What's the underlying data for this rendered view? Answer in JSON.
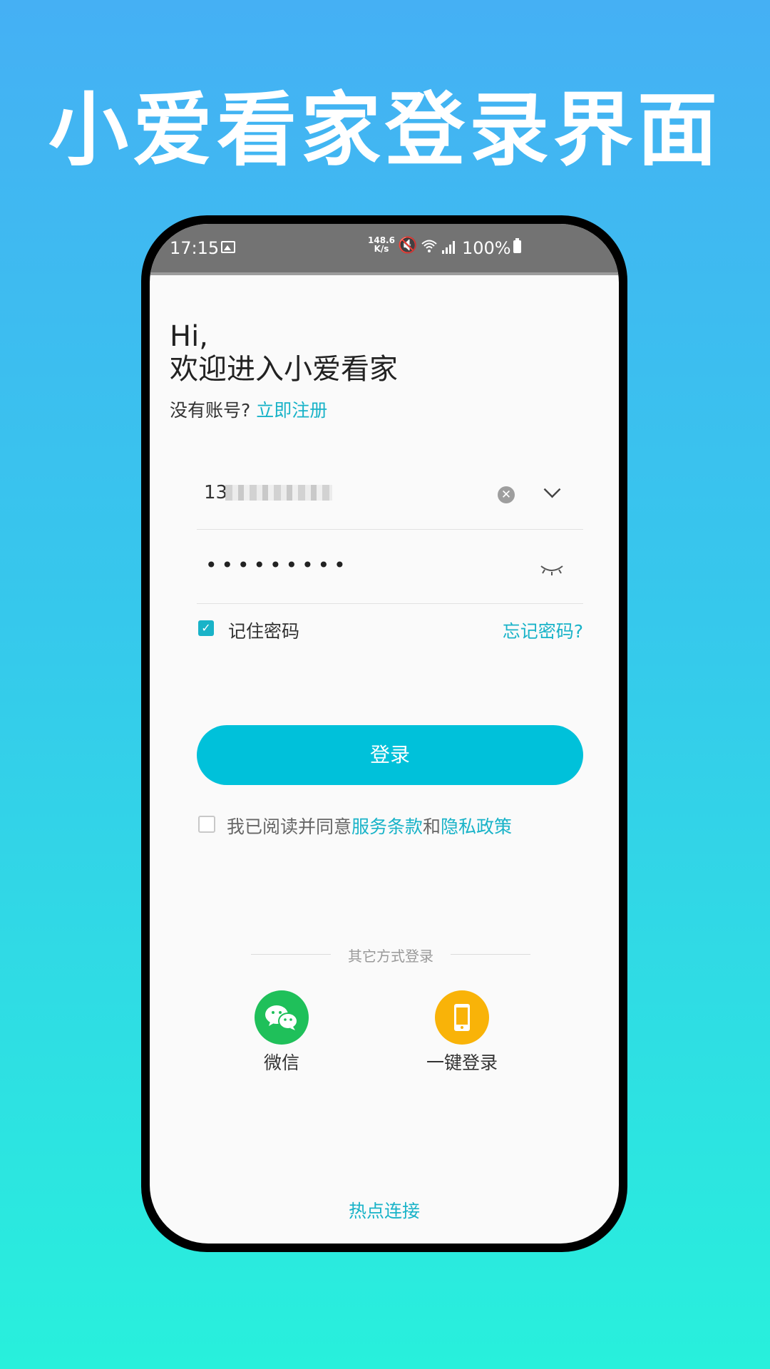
{
  "banner": {
    "title": "小爱看家登录界面"
  },
  "statusbar": {
    "time": "17:15",
    "speed_top": "148.6",
    "speed_bottom": "K/s",
    "battery": "100%"
  },
  "greeting": {
    "line1": "Hi,",
    "line2": "欢迎进入小爱看家"
  },
  "register": {
    "prompt": "没有账号?",
    "link": "立即注册"
  },
  "form": {
    "phone_value": "13",
    "password_value": "•••••••••",
    "remember_label": "记住密码",
    "remember_checked": true,
    "forgot_label": "忘记密码?",
    "login_label": "登录"
  },
  "agreement": {
    "prefix": "我已阅读并同意",
    "terms": "服务条款",
    "and": "和",
    "privacy": "隐私政策"
  },
  "other_login": {
    "label": "其它方式登录",
    "wechat": "微信",
    "one_click": "一键登录"
  },
  "hotspot": {
    "label": "热点连接"
  },
  "colors": {
    "accent": "#19b3c8",
    "button": "#00c1da",
    "wechat": "#1fc05a",
    "one_click": "#f9b308"
  },
  "icons": [
    "image-icon",
    "mute-icon",
    "wifi-icon",
    "signal-icon",
    "battery-icon",
    "clear-icon",
    "chevron-down-icon",
    "eye-closed-icon",
    "checkbox-icon",
    "wechat-icon",
    "phone-icon"
  ]
}
